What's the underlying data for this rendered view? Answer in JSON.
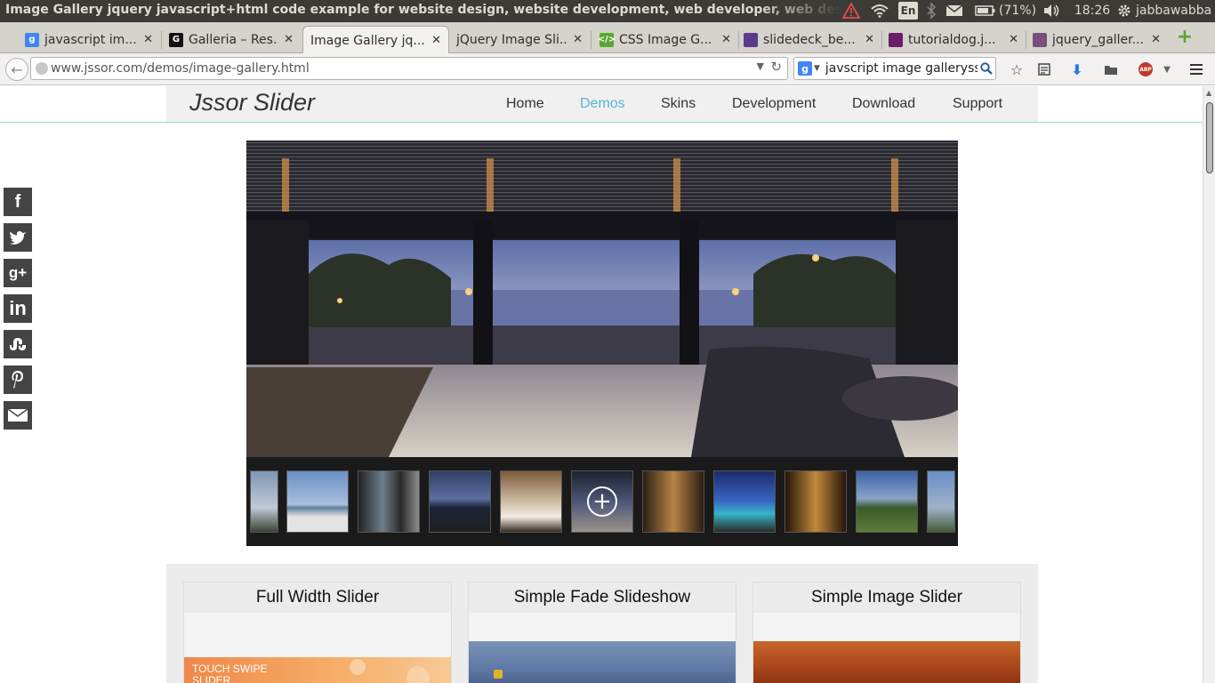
{
  "system": {
    "window_title": "Image Gallery jquery javascript+html code example for website design, website development, web developer, web design, web de",
    "keyboard_layout": "En",
    "battery": "(71%)",
    "time": "18:26",
    "user": "jabbawabba"
  },
  "tabs": [
    {
      "label": "javascript im...",
      "favicon": "google-icon",
      "color": "#4285f4"
    },
    {
      "label": "Galleria – Res...",
      "favicon": "galleria-icon",
      "color": "#111111"
    },
    {
      "label": "Image Gallery jq...",
      "favicon": "none",
      "active": true
    },
    {
      "label": "jQuery Image Sli...",
      "favicon": "none"
    },
    {
      "label": "CSS Image G...",
      "favicon": "css-icon",
      "color": "#5aa832"
    },
    {
      "label": "slidedeck_be...",
      "favicon": "slidedeck-icon",
      "color": "#5a3a8c"
    },
    {
      "label": "tutorialdog.j...",
      "favicon": "tutorialdog-icon",
      "color": "#6a1f6a"
    },
    {
      "label": "jquery_galler...",
      "favicon": "gallery-icon",
      "color": "#7a4f7a"
    }
  ],
  "toolbar": {
    "url": "www.jssor.com/demos/image-gallery.html",
    "search_value": "javscript image galleryss"
  },
  "site": {
    "logo": "Jssor Slider",
    "nav": [
      "Home",
      "Demos",
      "Skins",
      "Development",
      "Download",
      "Support"
    ],
    "active_nav": "Demos",
    "accent": "#5bb4d8"
  },
  "social": [
    "f",
    "t",
    "g+",
    "in",
    "su",
    "p",
    "mail"
  ],
  "cards": [
    {
      "title": "Full Width Slider",
      "caption": "TOUCH SWIPE SLIDER"
    },
    {
      "title": "Simple Fade Slideshow"
    },
    {
      "title": "Simple Image Slider"
    }
  ]
}
